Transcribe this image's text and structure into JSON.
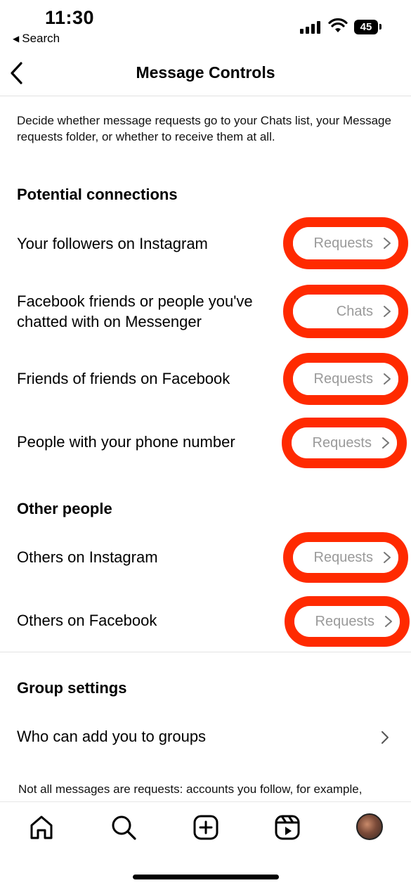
{
  "status": {
    "time": "11:30",
    "back_app": "Search",
    "battery": "45"
  },
  "header": {
    "title": "Message Controls"
  },
  "description": "Decide whether message requests go to your Chats list, your Message requests folder, or whether to receive them at all.",
  "potential": {
    "title": "Potential connections",
    "rows": [
      {
        "label": "Your followers on Instagram",
        "value": "Requests"
      },
      {
        "label": "Facebook friends or people you've chatted with on Messenger",
        "value": "Chats"
      },
      {
        "label": "Friends of friends on Facebook",
        "value": "Requests"
      },
      {
        "label": "People with your phone number",
        "value": "Requests"
      }
    ]
  },
  "other": {
    "title": "Other people",
    "rows": [
      {
        "label": "Others on Instagram",
        "value": "Requests"
      },
      {
        "label": "Others on Facebook",
        "value": "Requests"
      }
    ]
  },
  "group": {
    "title": "Group settings",
    "row_label": "Who can add you to groups"
  },
  "footnote": "Not all messages are requests: accounts you follow, for example, send messages to your Chats list. Learn more",
  "tabbar": {
    "items": [
      "home-icon",
      "search-icon",
      "create-icon",
      "reels-icon",
      "profile-avatar"
    ]
  },
  "colors": {
    "highlight": "#ff2a00",
    "value_text": "#9a9a9a"
  }
}
